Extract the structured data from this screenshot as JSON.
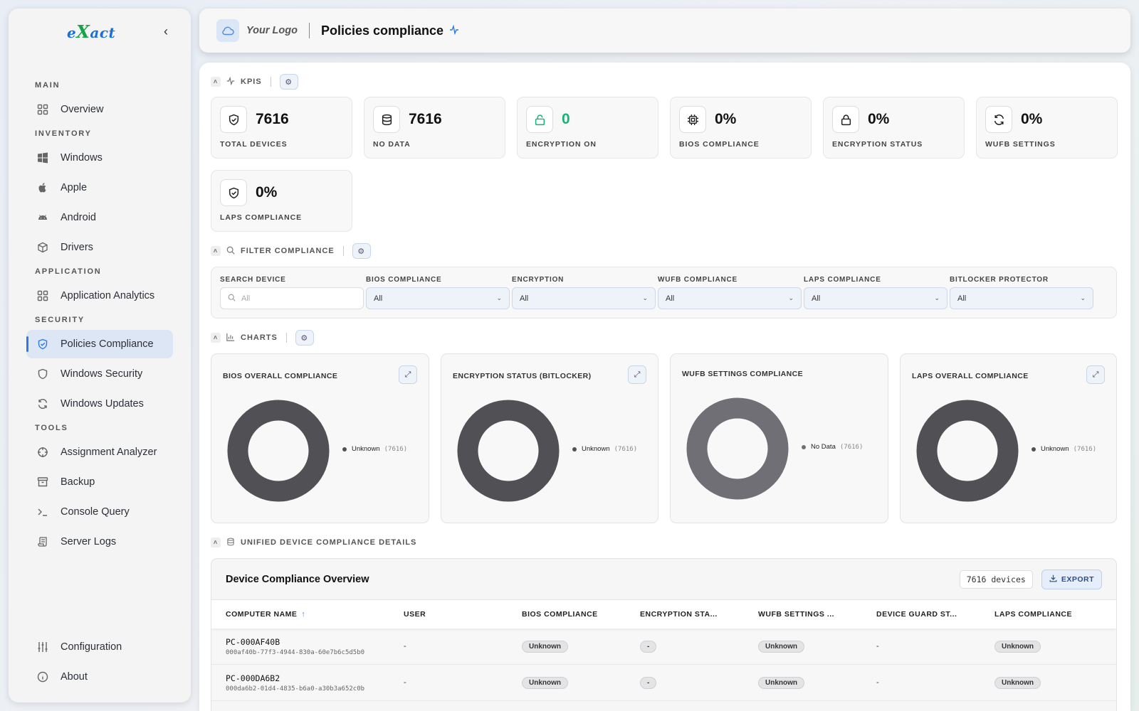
{
  "sidebar": {
    "brand": {
      "pre": "e",
      "x": "X",
      "post": "act"
    },
    "sections": {
      "main": "MAIN",
      "inventory": "INVENTORY",
      "application": "APPLICATION",
      "security": "SECURITY",
      "tools": "TOOLS"
    },
    "items": {
      "overview": "Overview",
      "windows": "Windows",
      "apple": "Apple",
      "android": "Android",
      "drivers": "Drivers",
      "app_analytics": "Application Analytics",
      "policies_compliance": "Policies Compliance",
      "windows_security": "Windows Security",
      "windows_updates": "Windows Updates",
      "assignment_analyzer": "Assignment Analyzer",
      "backup": "Backup",
      "console_query": "Console Query",
      "server_logs": "Server Logs",
      "configuration": "Configuration",
      "about": "About"
    }
  },
  "header": {
    "logo_text": "Your Logo",
    "title": "Policies compliance"
  },
  "kpis": {
    "section_label": "KPIS",
    "cards": [
      {
        "value": "7616",
        "label": "TOTAL DEVICES"
      },
      {
        "value": "7616",
        "label": "NO DATA"
      },
      {
        "value": "0",
        "label": "ENCRYPTION ON"
      },
      {
        "value": "0%",
        "label": "BIOS COMPLIANCE"
      },
      {
        "value": "0%",
        "label": "ENCRYPTION STATUS"
      },
      {
        "value": "0%",
        "label": "WUFB SETTINGS"
      },
      {
        "value": "0%",
        "label": "LAPS COMPLIANCE"
      }
    ]
  },
  "filters": {
    "section_label": "FILTER COMPLIANCE",
    "search_label": "SEARCH DEVICE",
    "search_placeholder": "All",
    "selects": [
      {
        "label": "BIOS COMPLIANCE",
        "value": "All"
      },
      {
        "label": "ENCRYPTION",
        "value": "All"
      },
      {
        "label": "WUFB COMPLIANCE",
        "value": "All"
      },
      {
        "label": "LAPS COMPLIANCE",
        "value": "All"
      },
      {
        "label": "BITLOCKER PROTECTOR",
        "value": "All"
      }
    ]
  },
  "charts": {
    "section_label": "CHARTS"
  },
  "chart_data": [
    {
      "type": "pie",
      "title": "BIOS OVERALL COMPLIANCE",
      "donut": true,
      "categories": [
        "Unknown"
      ],
      "values": [
        7616
      ],
      "colors": [
        "#505055"
      ]
    },
    {
      "type": "pie",
      "title": "ENCRYPTION STATUS (BITLOCKER)",
      "donut": true,
      "categories": [
        "Unknown"
      ],
      "values": [
        7616
      ],
      "colors": [
        "#505055"
      ]
    },
    {
      "type": "pie",
      "title": "WUFB SETTINGS COMPLIANCE",
      "donut": true,
      "categories": [
        "No Data"
      ],
      "values": [
        7616
      ],
      "colors": [
        "#6f6f75"
      ]
    },
    {
      "type": "pie",
      "title": "LAPS OVERALL COMPLIANCE",
      "donut": true,
      "categories": [
        "Unknown"
      ],
      "values": [
        7616
      ],
      "colors": [
        "#505055"
      ]
    }
  ],
  "details": {
    "section_label": "UNIFIED DEVICE COMPLIANCE DETAILS",
    "card_title": "Device Compliance Overview",
    "count": "7616 devices",
    "export_label": "EXPORT",
    "columns": [
      "COMPUTER NAME",
      "USER",
      "BIOS COMPLIANCE",
      "ENCRYPTION STA...",
      "WUFB SETTINGS ...",
      "DEVICE GUARD ST...",
      "LAPS COMPLIANCE"
    ],
    "rows": [
      {
        "name": "PC-000AF40B",
        "id": "000af40b-77f3-4944-830a-60e7b6c5d5b0",
        "user": "-",
        "bios": "Unknown",
        "encryption": "-",
        "wufb": "Unknown",
        "device_guard": "-",
        "laps": "Unknown"
      },
      {
        "name": "PC-000DA6B2",
        "id": "000da6b2-01d4-4835-b6a0-a30b3a652c0b",
        "user": "-",
        "bios": "Unknown",
        "encryption": "-",
        "wufb": "Unknown",
        "device_guard": "-",
        "laps": "Unknown"
      }
    ]
  },
  "colors": {
    "accent": "#2b7be0",
    "success": "#19b27a",
    "brand_blue": "#1b6fd6",
    "brand_green": "#16a34a"
  }
}
